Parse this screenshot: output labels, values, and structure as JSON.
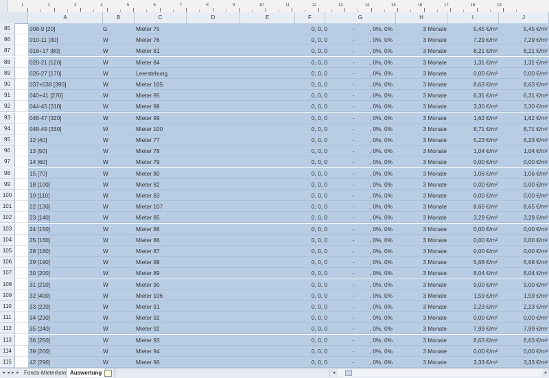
{
  "ruler": {
    "numbers": [
      "1",
      "2",
      "3",
      "4",
      "5",
      "6",
      "7",
      "8",
      "9",
      "10",
      "11",
      "12",
      "13",
      "14",
      "15",
      "16",
      "17",
      "18",
      "19"
    ]
  },
  "columns": [
    "A",
    "B",
    "C",
    "D",
    "E",
    "F",
    "G",
    "H",
    "I",
    "J"
  ],
  "rows": [
    {
      "n": "85",
      "a": "008-9 [20]",
      "b": "G",
      "c": "Mieter 75",
      "f": "0, 0, 0",
      "g1": "-",
      "g2": ", 0%, 0%",
      "h": "3 Monate",
      "i": "5,45 €/m²",
      "j": "5,45 €/m²"
    },
    {
      "n": "86",
      "a": "010-11 [30]",
      "b": "W",
      "c": "Mieter 76",
      "f": "0, 0, 0",
      "g1": "-",
      "g2": ", 0%, 0%",
      "h": "3 Monate",
      "i": "7,29 €/m²",
      "j": "7,29 €/m²"
    },
    {
      "n": "87",
      "a": "016+17 [80]",
      "b": "W",
      "c": "Mieter 81",
      "f": "0, 0, 0",
      "g1": "-",
      "g2": ", 0%, 0%",
      "h": "3 Monate",
      "i": "8,21 €/m²",
      "j": "8,21 €/m²"
    },
    {
      "n": "88",
      "a": "020-21 [120]",
      "b": "W",
      "c": "Mieter 84",
      "f": "0, 0, 0",
      "g1": "-",
      "g2": ", 0%, 0%",
      "h": "3 Monate",
      "i": "1,31 €/m²",
      "j": "1,31 €/m²"
    },
    {
      "n": "89",
      "a": "026-27 [170]",
      "b": "W",
      "c": "Leerstehung",
      "f": "0, 0, 0",
      "g1": "-",
      "g2": ", 0%, 0%",
      "h": "3 Monate",
      "i": "0,00 €/m²",
      "j": "0,00 €/m²"
    },
    {
      "n": "90",
      "a": "037+038 [390]",
      "b": "W",
      "c": "Mieter 105",
      "f": "0, 0, 0",
      "g1": "-",
      "g2": ", 0%, 0%",
      "h": "3 Monate",
      "i": "8,63 €/m²",
      "j": "8,63 €/m²"
    },
    {
      "n": "91",
      "a": "040+41 [270]",
      "b": "W",
      "c": "Mieter 95",
      "f": "0, 0, 0",
      "g1": "-",
      "g2": ", 0%, 0%",
      "h": "3 Monate",
      "i": "6,31 €/m²",
      "j": "6,31 €/m²"
    },
    {
      "n": "92",
      "a": "044-45 [310]",
      "b": "W",
      "c": "Mieter 98",
      "f": "0, 0, 0",
      "g1": "-",
      "g2": ", 0%, 0%",
      "h": "3 Monate",
      "i": "3,30 €/m²",
      "j": "3,30 €/m²"
    },
    {
      "n": "93",
      "a": "046-47 [320]",
      "b": "W",
      "c": "Mieter 99",
      "f": "0, 0, 0",
      "g1": "-",
      "g2": ", 0%, 0%",
      "h": "3 Monate",
      "i": "1,62 €/m²",
      "j": "1,62 €/m²"
    },
    {
      "n": "94",
      "a": "048-49 [330]",
      "b": "W",
      "c": "Mieter 100",
      "f": "0, 0, 0",
      "g1": "-",
      "g2": ", 0%, 0%",
      "h": "3 Monate",
      "i": "8,71 €/m²",
      "j": "8,71 €/m²"
    },
    {
      "n": "95",
      "a": "12 [40]",
      "b": "W",
      "c": "Mieter 77",
      "f": "0, 0, 0",
      "g1": "-",
      "g2": ", 0%, 0%",
      "h": "3 Monate",
      "i": "5,23 €/m²",
      "j": "6,23 €/m²"
    },
    {
      "n": "96",
      "a": "13 [50]",
      "b": "W",
      "c": "Mieter 78",
      "f": "0, 0, 0",
      "g1": "-",
      "g2": ", 0%, 0%",
      "h": "3 Monate",
      "i": "1,04 €/m²",
      "j": "1,04 €/m²"
    },
    {
      "n": "97",
      "a": "14 [60]",
      "b": "W",
      "c": "Mieter 79",
      "f": "0, 0, 0",
      "g1": "-",
      "g2": ", 0%, 0%",
      "h": "3 Monate",
      "i": "0,00 €/m²",
      "j": "0,00 €/m²"
    },
    {
      "n": "98",
      "a": "15 [70]",
      "b": "W",
      "c": "Mieter 80",
      "f": "0, 0, 0",
      "g1": "-",
      "g2": ", 0%, 0%",
      "h": "3 Monate",
      "i": "1,06 €/m²",
      "j": "1,06 €/m²"
    },
    {
      "n": "99",
      "a": "18 [100]",
      "b": "W",
      "c": "Mieter 82",
      "f": "0, 0, 0",
      "g1": "-",
      "g2": ", 0%, 0%",
      "h": "3 Monate",
      "i": "0,00 €/m²",
      "j": "0,00 €/m²"
    },
    {
      "n": "100",
      "a": "19 [110]",
      "b": "W",
      "c": "Mieter 83",
      "f": "0, 0, 0",
      "g1": "-",
      "g2": ", 0%, 0%",
      "h": "3 Monate",
      "i": "0,00 €/m²",
      "j": "0,00 €/m²"
    },
    {
      "n": "101",
      "a": "22 [130]",
      "b": "W",
      "c": "Mieter 107",
      "f": "0, 0, 0",
      "g1": "-",
      "g2": ", 0%, 0%",
      "h": "3 Monate",
      "i": "8,65 €/m²",
      "j": "8,65 €/m²"
    },
    {
      "n": "102",
      "a": "23 [140]",
      "b": "W",
      "c": "Mieter 85",
      "f": "0, 0, 0",
      "g1": "-",
      "g2": ", 0%, 0%",
      "h": "3 Monate",
      "i": "3,29 €/m²",
      "j": "3,29 €/m²"
    },
    {
      "n": "103",
      "a": "24 [150]",
      "b": "W",
      "c": "Mieter 86",
      "f": "0, 0, 0",
      "g1": "-",
      "g2": ", 0%, 0%",
      "h": "3 Monate",
      "i": "0,00 €/m²",
      "j": "0,00 €/m²"
    },
    {
      "n": "104",
      "a": "25 [160]",
      "b": "W",
      "c": "Mieter 86",
      "f": "0, 0, 0",
      "g1": "-",
      "g2": ", 0%, 0%",
      "h": "3 Monate",
      "i": "0,00 €/m²",
      "j": "0,00 €/m²"
    },
    {
      "n": "105",
      "a": "28 [180]",
      "b": "W",
      "c": "Mieter 87",
      "f": "0, 0, 0",
      "g1": "-",
      "g2": ", 0%, 0%",
      "h": "3 Monate",
      "i": "0,00 €/m²",
      "j": "0,00 €/m²"
    },
    {
      "n": "106",
      "a": "29 [190]",
      "b": "W",
      "c": "Mieter 88",
      "f": "0, 0, 0",
      "g1": "-",
      "g2": ", 0%, 0%",
      "h": "3 Monate",
      "i": "5,68 €/m²",
      "j": "5,68 €/m²"
    },
    {
      "n": "107",
      "a": "30 [200]",
      "b": "W",
      "c": "Mieter 89",
      "f": "0, 0, 0",
      "g1": "-",
      "g2": ", 0%, 0%",
      "h": "3 Monate",
      "i": "8,04 €/m²",
      "j": "8,04 €/m²"
    },
    {
      "n": "108",
      "a": "31 [210]",
      "b": "W",
      "c": "Mieter 90",
      "f": "0, 0, 0",
      "g1": "-",
      "g2": ", 0%, 0%",
      "h": "3 Monate",
      "i": "9,00 €/m²",
      "j": "9,00 €/m²"
    },
    {
      "n": "109",
      "a": "32 [400]",
      "b": "W",
      "c": "Mieter 106",
      "f": "0, 0, 0",
      "g1": "-",
      "g2": ", 0%, 0%",
      "h": "3 Monate",
      "i": "1,59 €/m²",
      "j": "1,59 €/m²"
    },
    {
      "n": "110",
      "a": "33 [220]",
      "b": "W",
      "c": "Mieter 91",
      "f": "0, 0, 0",
      "g1": "-",
      "g2": ", 0%, 0%",
      "h": "3 Monate",
      "i": "2,23 €/m²",
      "j": "2,23 €/m²"
    },
    {
      "n": "111",
      "a": "34 [230]",
      "b": "W",
      "c": "Mieter 92",
      "f": "0, 0, 0",
      "g1": "-",
      "g2": ", 0%, 0%",
      "h": "3 Monate",
      "i": "0,00 €/m²",
      "j": "0,00 €/m²"
    },
    {
      "n": "112",
      "a": "35 [240]",
      "b": "W",
      "c": "Mieter 92",
      "f": "0, 0, 0",
      "g1": "-",
      "g2": ", 0%, 0%",
      "h": "3 Monate",
      "i": "7,99 €/m²",
      "j": "7,99 €/m²"
    },
    {
      "n": "113",
      "a": "36 [250]",
      "b": "W",
      "c": "Mieter 93",
      "f": "0, 0, 0",
      "g1": "-",
      "g2": ", 0%, 0%",
      "h": "3 Monate",
      "i": "8,63 €/m²",
      "j": "8,63 €/m²"
    },
    {
      "n": "114",
      "a": "39 [260]",
      "b": "W",
      "c": "Mieter 94",
      "f": "0, 0, 0",
      "g1": "-",
      "g2": ", 0%, 0%",
      "h": "3 Monate",
      "i": "0,00 €/m²",
      "j": "0,00 €/m²"
    },
    {
      "n": "115",
      "a": "42 [290]",
      "b": "W",
      "c": "Mieter 96",
      "f": "0, 0, 0",
      "g1": "-",
      "g2": ", 0%, 0%",
      "h": "3 Monate",
      "i": "3,33 €/m²",
      "j": "3,33 €/m²"
    }
  ],
  "sheet_tabs": [
    {
      "label": "Fonds-Mieterliste",
      "active": false
    },
    {
      "label": "Auswertung",
      "active": true
    }
  ],
  "colors": {
    "selection": "#b8cce4",
    "header": "#e8edf5"
  }
}
